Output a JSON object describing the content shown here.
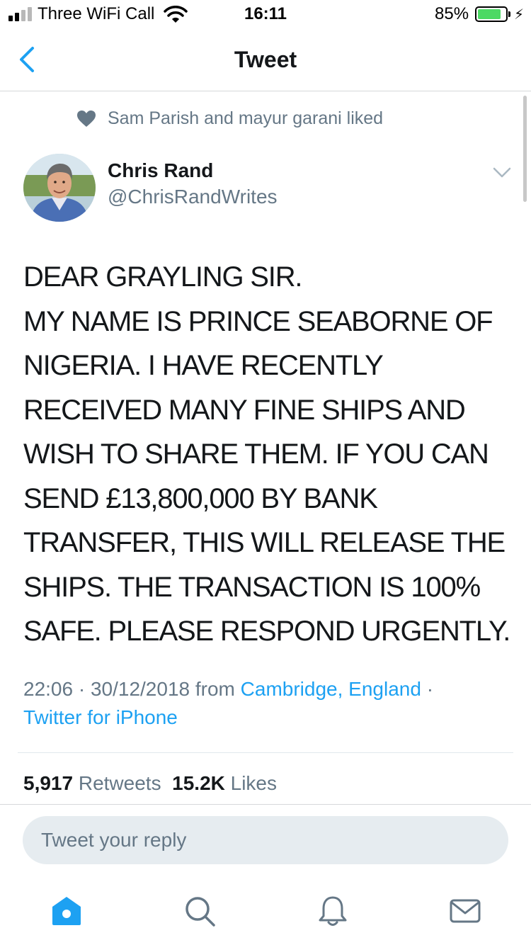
{
  "status_bar": {
    "carrier": "Three WiFi Call",
    "time": "16:11",
    "battery_percent": "85%",
    "battery_level": 0.85,
    "signal_bars": 4,
    "signal_bars_filled": 2
  },
  "nav": {
    "title": "Tweet",
    "back_icon": "chevron-left-icon"
  },
  "social_context": {
    "icon": "heart-icon",
    "text": "Sam Parish and mayur garani liked"
  },
  "author": {
    "name": "Chris Rand",
    "handle": "@ChrisRandWrites"
  },
  "tweet": {
    "lines": [
      "DEAR GRAYLING SIR.",
      "MY NAME IS PRINCE SEABORNE OF",
      "NIGERIA. I HAVE RECENTLY",
      "RECEIVED MANY FINE SHIPS AND",
      "WISH TO SHARE THEM. IF YOU CAN",
      "SEND £13,800,000 BY BANK",
      "TRANSFER, THIS WILL RELEASE THE",
      "SHIPS. THE TRANSACTION IS 100%",
      "SAFE. PLEASE RESPOND URGENTLY."
    ],
    "timestamp": "22:06 · 30/12/2018",
    "from_label": "from",
    "location": "Cambridge, England",
    "separator": "·",
    "source": "Twitter for iPhone"
  },
  "stats": {
    "retweets_count": "5,917",
    "retweets_label": "Retweets",
    "likes_count": "15.2K",
    "likes_label": "Likes"
  },
  "reply": {
    "placeholder": "Tweet your reply"
  },
  "tabbar": {
    "items": [
      {
        "name": "home-icon",
        "active": true
      },
      {
        "name": "search-icon",
        "active": false
      },
      {
        "name": "notifications-icon",
        "active": false
      },
      {
        "name": "messages-icon",
        "active": false
      }
    ]
  },
  "colors": {
    "accent": "#1da1f2",
    "secondary_text": "#657786",
    "primary_text": "#14171a",
    "battery": "#4cd964"
  }
}
